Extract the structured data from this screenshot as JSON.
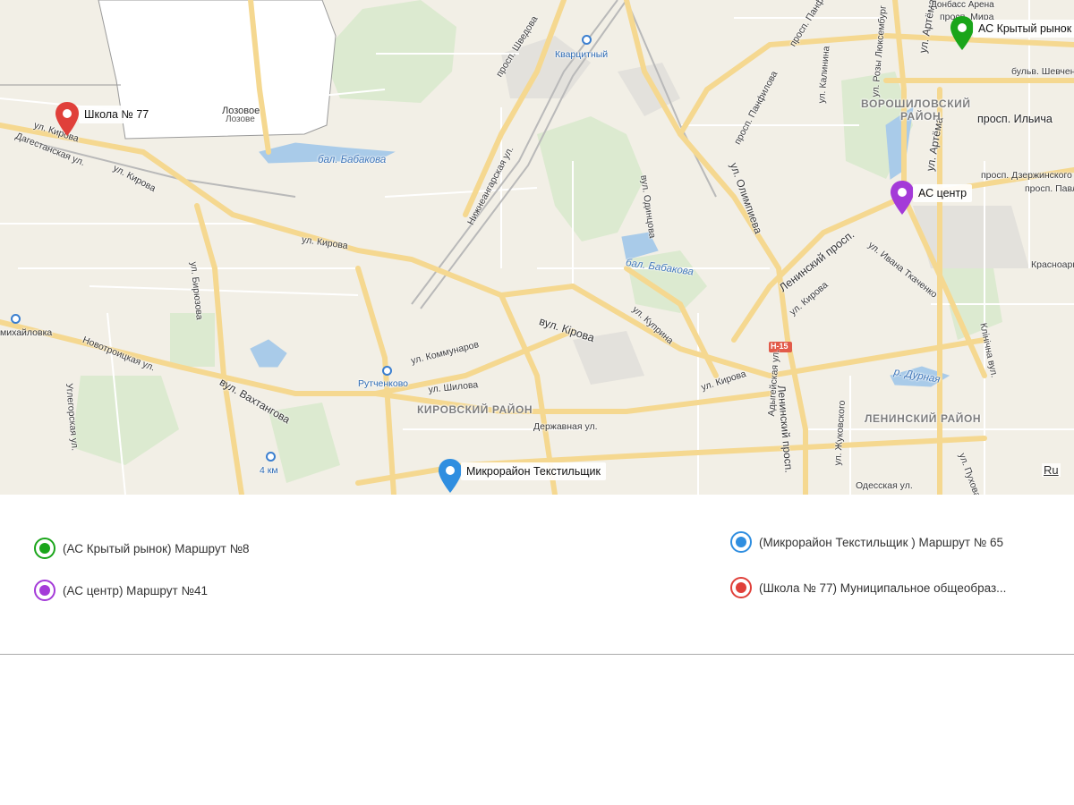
{
  "map": {
    "labels": {
      "school77": "Школа № 77",
      "lozovoe_ua": "Лозовое",
      "lozovoe_ru": "Лозове",
      "kirova_nw": "ул. Кирова",
      "dagestanskaya": "Дагестанская ул.",
      "kirova_w": "ул. Кирова",
      "kirova_mid": "ул. Кирова",
      "bal_babakova_1": "бал. Бабакова",
      "bal_babakova_2": "бал. Бабакова",
      "nizhneangarskaya": "Нижнеангарская ул.",
      "shvedova": "просп. Шведова",
      "kvartsitnyi": "Кварцитный",
      "odintsova": "вул. Одинцова",
      "olimpieva": "ул. Олимпиева",
      "pamfilova": "просп. Панфилова",
      "kalinina": "ул. Калинина",
      "artema_1": "ул. Артёма",
      "artema_2": "ул. Артёма",
      "lyuksemburg": "ул. Розы Люксембург",
      "donbass_arena": "Донбасс Арена",
      "prosp_mira": "просп. Мира",
      "bulv_shevchenko": "бульв. Шевченко",
      "voroshilovsky": "ВОРОШИЛОВСКИЙ",
      "raion": "РАЙОН",
      "prosp_ilicha": "просп. Ильича",
      "dzerzhinskogo": "просп. Дзержинского",
      "pavlova": "просп. Павлова",
      "leninsky_prosp": "Ленинский просп.",
      "leninsky_prosp_2": "Ленинский просп.",
      "tkachenko": "ул. Ивана Ткаченко",
      "krasnoarm": "Красноармейская",
      "kirova_se": "ул. Кирова",
      "kupriina": "ул. Куприна",
      "vul_kirova": "вул. Кірова",
      "kirova_s": "ул. Кирова",
      "biryuzova": "ул. Бирюзова",
      "kommunarov": "ул. Коммунаров",
      "shilova": "ул. Шилова",
      "rutchenkovo": "Рутченково",
      "kirovsky": "КИРОВСКИЙ РАЙОН",
      "derzhavnaya": "Державная ул.",
      "novotroitskaya": "Новотроицкая ул.",
      "vakhtangova": "вул. Вахтангова",
      "uglegorskaya": "Углегорская ул.",
      "mikhaylovka": "михайловка",
      "km4": "4 км",
      "r_durnaya": "р. Дурная",
      "leninsky_raion": "ЛЕНИНСКИЙ РАЙОН",
      "adygeyskaya": "Адыгейская ул.",
      "zhukovskogo": "ул. Жуковского",
      "pukhova": "ул. Пухова",
      "klinichna": "Клінічна вул.",
      "odesskaya": "Одесская ул.",
      "h15": "Н-15",
      "textile": "Микрорайон Текстильщик",
      "as_centr": "АС центр",
      "krytyi_rynok": "АС Крытый рынок"
    },
    "ru_link": "Ru"
  },
  "pins": {
    "green": "#1aa51a",
    "purple": "#a43ad8",
    "blue": "#2f8ee0",
    "red": "#e0403a"
  },
  "legend": {
    "items": [
      {
        "label": "(АС Крытый рынок) Маршрут №8",
        "color": "#1aa51a"
      },
      {
        "label": "(АС центр) Маршрут №41",
        "color": "#a43ad8"
      },
      {
        "label": "(Микрорайон Текстильщик ) Маршрут № 65",
        "color": "#2f8ee0"
      },
      {
        "label": "(Школа № 77) Муниципальное общеобраз...",
        "color": "#e0403a"
      }
    ]
  }
}
